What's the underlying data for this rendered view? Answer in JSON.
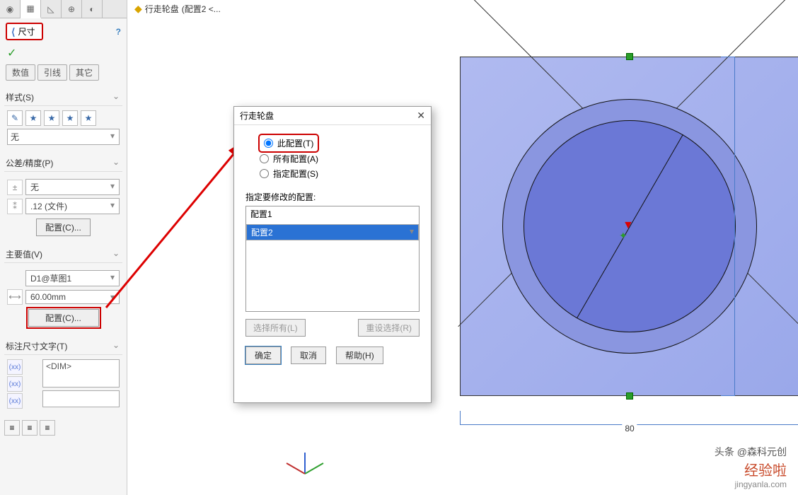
{
  "header": {
    "title": "尺寸"
  },
  "subtabs": [
    "数值",
    "引线",
    "其它"
  ],
  "sections": {
    "style": {
      "label": "样式(S)",
      "dropdown": "无"
    },
    "tol": {
      "label": "公差/精度(P)",
      "tolerance": "无",
      "precision": ".12 (文件)",
      "config_btn": "配置(C)..."
    },
    "mainval": {
      "label": "主要值(V)",
      "name": "D1@草图1",
      "value": "60.00mm",
      "config_btn": "配置(C)..."
    },
    "dimtext": {
      "label": "标注尺寸文字(T)",
      "value": "<DIM>"
    }
  },
  "crumb": {
    "part": "行走轮盘",
    "config": "(配置2 <..."
  },
  "dims": {
    "width": "80"
  },
  "dialog": {
    "title": "行走轮盘",
    "options": {
      "this": "此配置(T)",
      "all": "所有配置(A)",
      "spec": "指定配置(S)"
    },
    "list_label": "指定要修改的配置:",
    "items": [
      "配置1",
      "配置2"
    ],
    "select_all": "选择所有(L)",
    "reset": "重设选择(R)",
    "ok": "确定",
    "cancel": "取消",
    "help": "帮助(H)"
  },
  "watermark": {
    "headline": "头条 @森科元创",
    "brand": "经验啦",
    "url": "jingyanla.com"
  }
}
